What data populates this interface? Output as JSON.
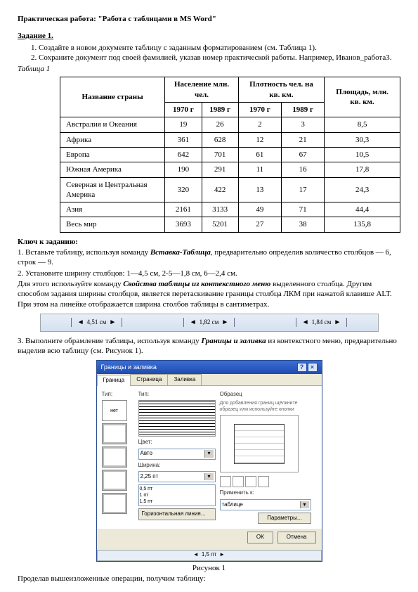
{
  "title": "Практическая работа:  \"Работа с таблицами в   MS Word\"",
  "task1": {
    "heading": "Задание 1.",
    "items": [
      "Создайте в новом документе таблицу с заданным форматированием (см. Таблица 1).",
      "Сохраните документ под своей фамилией, указав номер практической работы. Например, Иванов_работа3."
    ],
    "table_label": "Таблица 1"
  },
  "table": {
    "headers": {
      "country": "Название страны",
      "pop": "Население млн. чел.",
      "density": "Плотность\nчел. на кв. км.",
      "area": "Площадь,\nмлн. кв. км.",
      "y1": "1970 г",
      "y2": "1989 г"
    },
    "rows": [
      {
        "name": "Австралия и Океания",
        "p1": "19",
        "p2": "26",
        "d1": "2",
        "d2": "3",
        "a": "8,5"
      },
      {
        "name": "Африка",
        "p1": "361",
        "p2": "628",
        "d1": "12",
        "d2": "21",
        "a": "30,3"
      },
      {
        "name": "Европа",
        "p1": "642",
        "p2": "701",
        "d1": "61",
        "d2": "67",
        "a": "10,5"
      },
      {
        "name": "Южная Америка",
        "p1": "190",
        "p2": "291",
        "d1": "11",
        "d2": "16",
        "a": "17,8"
      },
      {
        "name": "Северная и Центральная Америка",
        "p1": "320",
        "p2": "422",
        "d1": "13",
        "d2": "17",
        "a": "24,3"
      },
      {
        "name": "Азия",
        "p1": "2161",
        "p2": "3133",
        "d1": "49",
        "d2": "71",
        "a": "44,4"
      },
      {
        "name": "Весь мир",
        "p1": "3693",
        "p2": "5201",
        "d1": "27",
        "d2": "38",
        "a": "135,8"
      }
    ]
  },
  "key": {
    "heading": "Ключ к заданию:",
    "p1a": "1. Вставьте таблицу, используя команду ",
    "p1b": "Вставка-Таблица",
    "p1c": ", предварительно определив количество столбцов — 6, строк — 9.",
    "p2": "2. Установите ширину столбцов: 1—4,5 см, 2-5—1,8 см, 6—2,4 см.",
    "p3a": "Для этого используйте команду ",
    "p3b": "Свойства таблицы из контекстного меню",
    "p3c": " выделенного столбца. Другим способом задания ширины столбцов, является перетаскивание границы столбца ЛКМ при нажатой клавише ALT. При этом на линейке отображается ширина столбов таблицы в сантиметрах."
  },
  "ruler": {
    "s1": "4,51 см",
    "s2": "1,82 см",
    "s3": "1,84 см"
  },
  "step3": {
    "a": "3. Выполните обрамление таблицы, используя команду ",
    "b": "Границы и заливка",
    "c": " из контекстного меню, предварительно выделив всю таблицу (см. Рисунок 1)."
  },
  "dialog": {
    "title": "Границы и заливка",
    "tabs": [
      "Граница",
      "Страница",
      "Заливка"
    ],
    "left_label": "Тип:",
    "thumbs": [
      "нет",
      "рамка",
      "все",
      "сетка",
      "другая"
    ],
    "mid": {
      "type": "Тип:",
      "color": "Цвет:",
      "color_val": "Авто",
      "width": "Ширина:",
      "width_val": "2,25 пт",
      "opts": [
        "0,5 пт",
        "1 пт",
        "1,5 пт"
      ]
    },
    "right": {
      "sample": "Образец",
      "hint": "Для добавления границ щёлкните образец или используйте кнопки",
      "apply": "Применить к:",
      "apply_val": "таблице",
      "params": "Параметры..."
    },
    "hline": "Горизонтальная линия...",
    "ruler2": "1,5 пт",
    "ok": "ОК",
    "cancel": "Отмена"
  },
  "fig": "Рисунок 1",
  "final": "Проделав вышеизложенные операции, получим таблицу:"
}
